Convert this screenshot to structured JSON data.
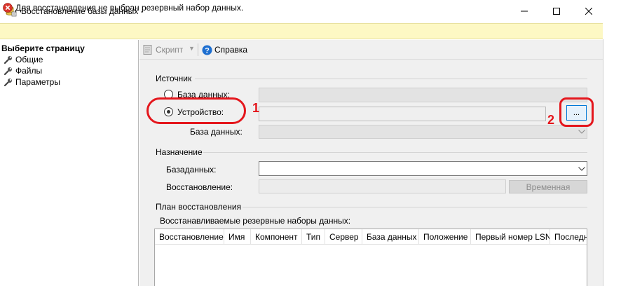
{
  "window": {
    "title": "Восстановление базы данных -"
  },
  "error_bar": {
    "message": "Для восстановления не выбран резервный набор данных."
  },
  "left_panel": {
    "header": "Выберите страницу",
    "items": [
      {
        "label": "Общие"
      },
      {
        "label": "Файлы"
      },
      {
        "label": "Параметры"
      }
    ]
  },
  "toolbar": {
    "script_label": "Скрипт",
    "help_label": "Справка"
  },
  "source": {
    "group_label": "Источник",
    "database_radio": "База данных:",
    "device_radio": "Устройство:",
    "device_database_label": "База данных:",
    "browse_label": "..."
  },
  "destination": {
    "group_label": "Назначение",
    "database_label": "Базаданных:",
    "restore_label": "Восстановление:",
    "timeline_button": "Временная"
  },
  "plan": {
    "group_label": "План восстановления",
    "sets_label": "Восстанавливаемые резервные наборы данных:",
    "columns": [
      "Восстановление",
      "Имя",
      "Компонент",
      "Тип",
      "Сервер",
      "База данных",
      "Положение",
      "Первый номер LSN",
      "Последн"
    ]
  },
  "annotations": {
    "one": "1",
    "two": "2",
    "color": "#e4161c"
  }
}
